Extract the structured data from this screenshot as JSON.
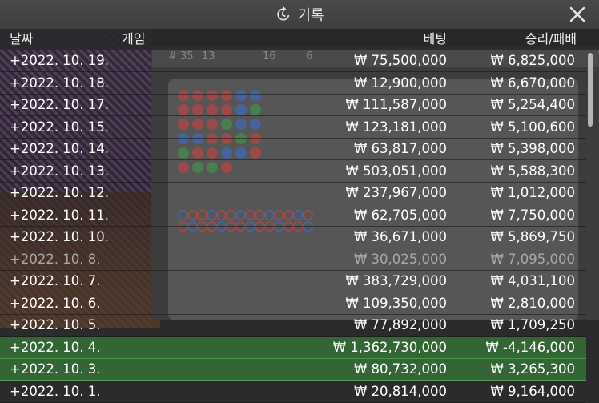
{
  "window": {
    "title": "기록",
    "title_icon": "history-icon",
    "close_icon": "close-icon"
  },
  "columns": {
    "date": "날짜",
    "game": "게임",
    "bet": "베팅",
    "result": "승리/패배"
  },
  "records": [
    {
      "date": "+2022. 10. 19.",
      "bet": "₩ 75,500,000",
      "result": "₩ 6,825,000",
      "state": "normal"
    },
    {
      "date": "+2022. 10. 18.",
      "bet": "₩ 12,900,000",
      "result": "₩ 6,670,000",
      "state": "normal"
    },
    {
      "date": "+2022. 10. 17.",
      "bet": "₩ 111,587,000",
      "result": "₩ 5,254,400",
      "state": "normal"
    },
    {
      "date": "+2022. 10. 15.",
      "bet": "₩ 123,181,000",
      "result": "₩ 5,100,600",
      "state": "normal"
    },
    {
      "date": "+2022. 10. 14.",
      "bet": "₩ 63,817,000",
      "result": "₩ 5,398,000",
      "state": "normal"
    },
    {
      "date": "+2022. 10. 13.",
      "bet": "₩ 503,051,000",
      "result": "₩ 5,588,300",
      "state": "normal"
    },
    {
      "date": "+2022. 10. 12.",
      "bet": "₩ 237,967,000",
      "result": "₩ 1,012,000",
      "state": "normal"
    },
    {
      "date": "+2022. 10. 11.",
      "bet": "₩ 62,705,000",
      "result": "₩ 7,750,000",
      "state": "normal"
    },
    {
      "date": "+2022. 10. 10.",
      "bet": "₩ 36,671,000",
      "result": "₩ 5,869,750",
      "state": "normal"
    },
    {
      "date": "+2022. 10. 8.",
      "bet": "₩ 30,025,000",
      "result": "₩ 7,095,000",
      "state": "dim"
    },
    {
      "date": "+2022. 10. 7.",
      "bet": "₩ 383,729,000",
      "result": "₩ 4,031,100",
      "state": "normal"
    },
    {
      "date": "+2022. 10. 6.",
      "bet": "₩ 109,350,000",
      "result": "₩ 2,810,000",
      "state": "normal"
    },
    {
      "date": "+2022. 10. 5.",
      "bet": "₩ 77,892,000",
      "result": "₩ 1,709,250",
      "state": "normal"
    },
    {
      "date": "+2022. 10. 4.",
      "bet": "₩ 1,362,730,000",
      "result": "₩ -4,146,000",
      "state": "highlight"
    },
    {
      "date": "+2022. 10. 3.",
      "bet": "₩ 80,732,000",
      "result": "₩ 3,265,300",
      "state": "highlight"
    },
    {
      "date": "+2022. 10. 1.",
      "bet": "₩ 20,814,000",
      "result": "₩ 9,164,000",
      "state": "normal"
    }
  ],
  "background": {
    "stats": [
      "# 35",
      "13",
      "16",
      "6"
    ]
  },
  "colors": {
    "highlight": "#3c963c",
    "dim_text": "#a8a8a8",
    "banker": "#d94040",
    "player": "#3a6fd9",
    "tie": "#3fa04a"
  }
}
